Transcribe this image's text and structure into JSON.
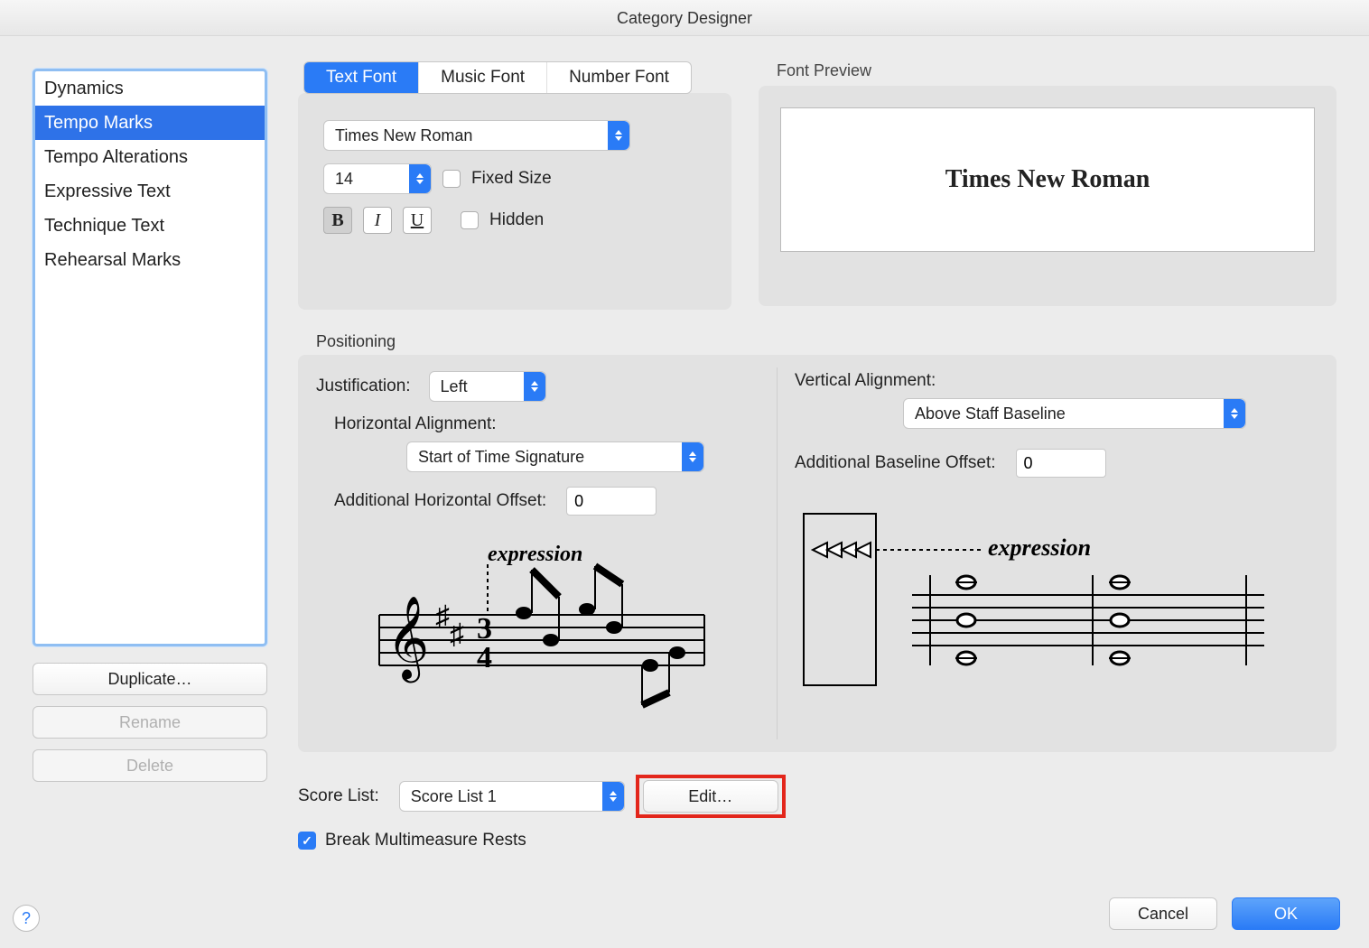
{
  "window": {
    "title": "Category Designer"
  },
  "categories": {
    "items": [
      "Dynamics",
      "Tempo Marks",
      "Tempo Alterations",
      "Expressive Text",
      "Technique Text",
      "Rehearsal Marks"
    ],
    "selected_index": 1
  },
  "left_buttons": {
    "duplicate": "Duplicate…",
    "rename": "Rename",
    "delete": "Delete"
  },
  "font_tabs": {
    "text": "Text Font",
    "music": "Music Font",
    "number": "Number Font",
    "active": 0
  },
  "font_settings": {
    "family": "Times New Roman",
    "size": "14",
    "fixed_size_label": "Fixed Size",
    "fixed_size_checked": false,
    "hidden_label": "Hidden",
    "hidden_checked": false,
    "bold": "B",
    "italic": "I",
    "underline": "U"
  },
  "preview": {
    "label": "Font Preview",
    "sample": "Times New Roman"
  },
  "positioning": {
    "legend": "Positioning",
    "justification_label": "Justification:",
    "justification_value": "Left",
    "h_align_label": "Horizontal Alignment:",
    "h_align_value": "Start of Time Signature",
    "h_offset_label": "Additional Horizontal Offset:",
    "h_offset_value": "0",
    "v_align_label": "Vertical Alignment:",
    "v_align_value": "Above Staff Baseline",
    "v_offset_label": "Additional Baseline Offset:",
    "v_offset_value": "0",
    "expression_word": "expression"
  },
  "score_list": {
    "label": "Score List:",
    "value": "Score List 1",
    "edit_label": "Edit…"
  },
  "break_rests": {
    "label": "Break Multimeasure Rests",
    "checked": true
  },
  "footer": {
    "cancel": "Cancel",
    "ok": "OK",
    "help": "?"
  }
}
